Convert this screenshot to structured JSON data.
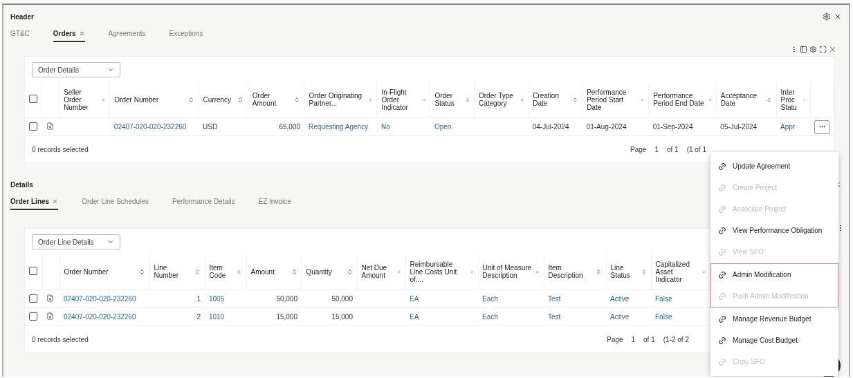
{
  "header": {
    "title": "Header",
    "tabs": [
      {
        "label": "GT&C",
        "selected": false,
        "closable": false
      },
      {
        "label": "Orders",
        "selected": true,
        "closable": true
      },
      {
        "label": "Agreements",
        "selected": false,
        "closable": false
      },
      {
        "label": "Exceptions",
        "selected": false,
        "closable": false
      }
    ],
    "view_select": "Order Details",
    "table": {
      "all_checked": false,
      "columns": [
        {
          "label": "Seller Order Number"
        },
        {
          "label": "Order Number",
          "numeric": false
        },
        {
          "label": "Currency",
          "numeric": false
        },
        {
          "label": "Order Amount",
          "numeric": true
        },
        {
          "label": "Order Originating Partner...",
          "numeric": false
        },
        {
          "label": "In-Flight Order Indicator",
          "numeric": false
        },
        {
          "label": "Order Status",
          "numeric": false
        },
        {
          "label": "Order Type Category"
        },
        {
          "label": "Creation Date",
          "numeric": false
        },
        {
          "label": "Performance Period Start Date",
          "numeric": false
        },
        {
          "label": "Performance Period End Date",
          "numeric": false
        },
        {
          "label": "Acceptance Date",
          "numeric": false
        },
        {
          "label": "Inter Proc Statu",
          "numeric": false
        }
      ],
      "rows": [
        {
          "checked": false,
          "cells": [
            null,
            {
              "text": "02407-020-020-232260",
              "link": true
            },
            {
              "text": "USD",
              "link": false
            },
            {
              "text": "65,000",
              "link": false
            },
            {
              "text": "Requesting Agency",
              "link": true
            },
            {
              "text": "No",
              "link": true
            },
            {
              "text": "Open",
              "link": true
            },
            null,
            {
              "text": "04-Jul-2024",
              "link": false
            },
            {
              "text": "01-Aug-2024",
              "link": false
            },
            {
              "text": "01-Sep-2024",
              "link": false
            },
            {
              "text": "05-Jul-2024",
              "link": false
            },
            {
              "text": "Appr",
              "link": true
            }
          ]
        }
      ]
    },
    "footer": "0 records selected",
    "pagination": {
      "label": "Page",
      "page": "1",
      "of": "of 1",
      "range": "(1 of 1"
    }
  },
  "details": {
    "title": "Details",
    "tabs": [
      {
        "label": "Order Lines",
        "selected": true,
        "closable": true
      },
      {
        "label": "Order Line Schedules",
        "selected": false,
        "closable": false
      },
      {
        "label": "Performance Details",
        "selected": false,
        "closable": false
      },
      {
        "label": "EZ Invoice",
        "selected": false,
        "closable": false
      }
    ],
    "view_select": "Order Line Details",
    "table": {
      "all_checked": false,
      "columns": [
        {
          "label": "Order Number",
          "numeric": false
        },
        {
          "label": "Line Number",
          "numeric": true
        },
        {
          "label": "Item Code",
          "numeric": false
        },
        {
          "label": "Amount",
          "numeric": true
        },
        {
          "label": "Quantity",
          "numeric": true
        },
        {
          "label": "Net Due Amount"
        },
        {
          "label": "Reimbursable Line Costs Unit of....",
          "numeric": false
        },
        {
          "label": "Unit of Measure Description",
          "numeric": false
        },
        {
          "label": "Item Description",
          "numeric": false
        },
        {
          "label": "Line Status",
          "numeric": false
        },
        {
          "label": "Capitalized Asset Indicator",
          "numeric": false
        }
      ],
      "rows": [
        {
          "checked": false,
          "cells": [
            {
              "text": "02407-020-020-232260",
              "link": true
            },
            {
              "text": "1",
              "link": false
            },
            {
              "text": "1005",
              "link": true
            },
            {
              "text": "50,000",
              "link": false
            },
            {
              "text": "50,000",
              "link": false
            },
            null,
            {
              "text": "EA",
              "link": true
            },
            {
              "text": "Each",
              "link": true
            },
            {
              "text": "Test",
              "link": true
            },
            {
              "text": "Active",
              "link": true
            },
            {
              "text": "False",
              "link": true
            }
          ]
        },
        {
          "checked": false,
          "cells": [
            {
              "text": "02407-020-020-232260",
              "link": true
            },
            {
              "text": "2",
              "link": false
            },
            {
              "text": "1010",
              "link": true
            },
            {
              "text": "15,000",
              "link": false
            },
            {
              "text": "15,000",
              "link": false
            },
            null,
            {
              "text": "EA",
              "link": true
            },
            {
              "text": "Each",
              "link": true
            },
            {
              "text": "Test",
              "link": true
            },
            {
              "text": "Active",
              "link": true
            },
            {
              "text": "False",
              "link": true
            }
          ]
        }
      ]
    },
    "footer": "0 records selected",
    "pagination": {
      "label": "Page",
      "page": "1",
      "of": "of 1",
      "range": "(1-2 of 2"
    }
  },
  "menu": {
    "sections": [
      {
        "outlined": false,
        "items": [
          {
            "label": "Update Agreement",
            "disabled": false
          },
          {
            "label": "Create Project",
            "disabled": true
          },
          {
            "label": "Associate Project",
            "disabled": true
          },
          {
            "label": "View Performance Obligation",
            "disabled": false
          },
          {
            "label": "View SFO",
            "disabled": true
          }
        ]
      },
      {
        "outlined": true,
        "items": [
          {
            "label": "Admin Modification",
            "disabled": false
          },
          {
            "label": "Push Admin Modification",
            "disabled": true
          }
        ]
      },
      {
        "outlined": false,
        "items": [
          {
            "label": "Manage Revenue Budget",
            "disabled": false
          },
          {
            "label": "Manage Cost Budget",
            "disabled": false
          },
          {
            "label": "Copy SFO",
            "disabled": true
          }
        ]
      }
    ]
  }
}
